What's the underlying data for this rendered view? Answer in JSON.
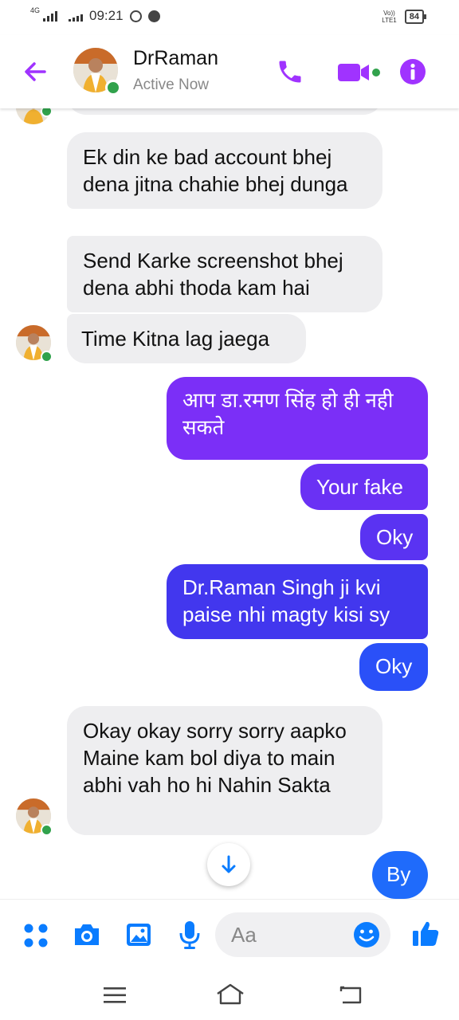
{
  "status_bar": {
    "network": "4G",
    "time": "09:21",
    "volte": [
      "Vo))",
      "LTE1"
    ],
    "battery": "84"
  },
  "header": {
    "name": "DrRaman",
    "status": "Active Now"
  },
  "messages": [
    {
      "sender": "them",
      "text": "Ek din ke bad account bhej dena jitna chahie bhej dunga"
    },
    {
      "sender": "them",
      "text": "Send Karke screenshot bhej dena abhi thoda kam hai"
    },
    {
      "sender": "them",
      "text": "Time Kitna lag jaega"
    },
    {
      "sender": "me",
      "text": "आप डा.रमण सिंह हो ही नही सकते"
    },
    {
      "sender": "me",
      "text": "Your fake"
    },
    {
      "sender": "me",
      "text": "Oky"
    },
    {
      "sender": "me",
      "text": "Dr.Raman Singh ji kvi paise nhi magty kisi sy"
    },
    {
      "sender": "me",
      "text": "Oky"
    },
    {
      "sender": "them",
      "text": "Okay okay sorry sorry aapko Maine kam bol diya to main abhi vah ho hi Nahin Sakta"
    },
    {
      "sender": "me",
      "text": "By"
    }
  ],
  "composer": {
    "placeholder": "Aa"
  },
  "colors": {
    "accent": "#a033ff",
    "blue": "#0a7cff",
    "purple_bubble": "#7b2ff7",
    "mid_bubble": "#4e35f0",
    "blue_bubble": "#1f6bfb",
    "online": "#31a24c"
  }
}
